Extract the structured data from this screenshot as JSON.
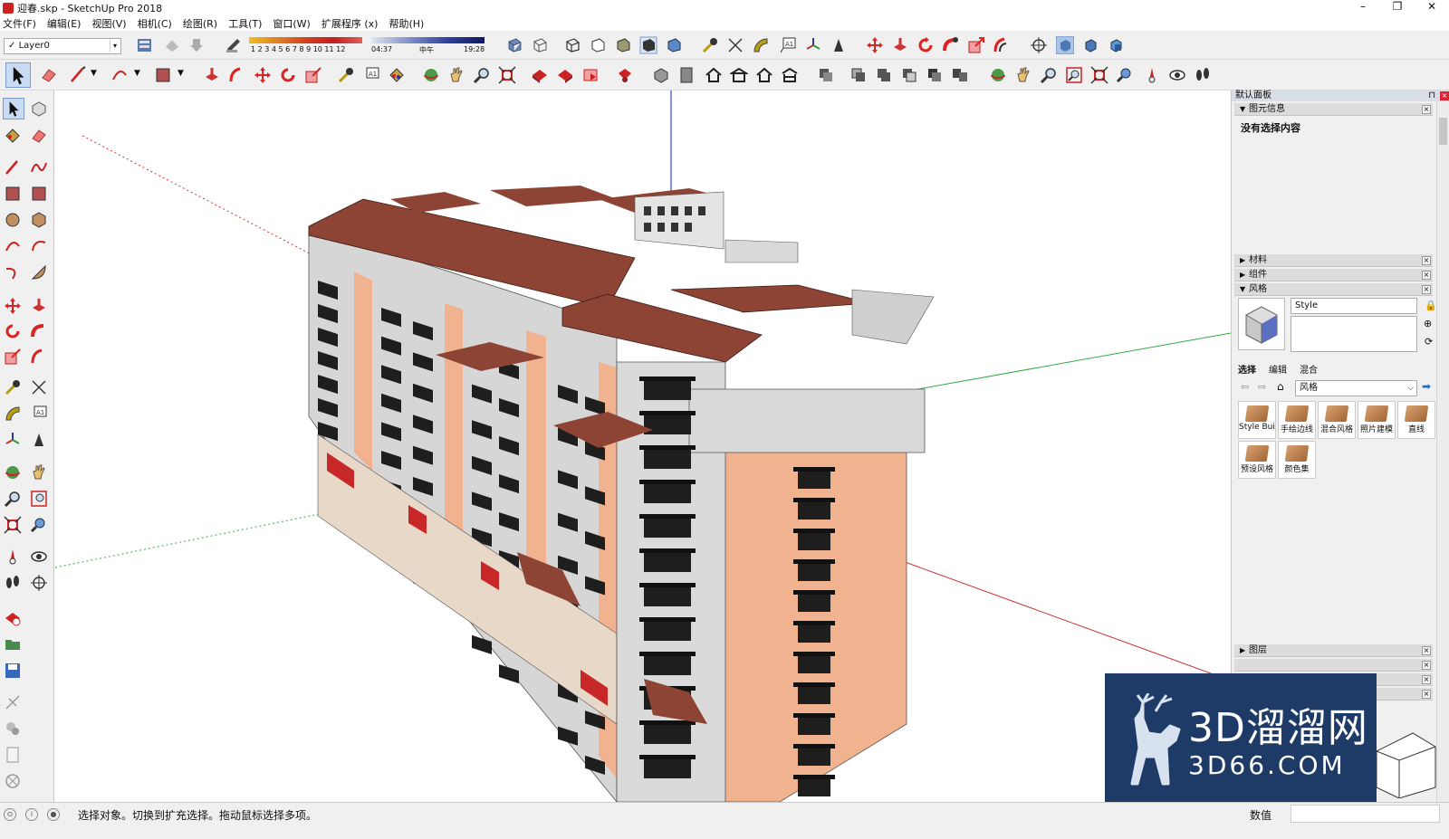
{
  "window": {
    "title": "迎春.skp - SketchUp Pro 2018",
    "minimize": "–",
    "maximize": "❐",
    "close": "✕"
  },
  "menu": [
    "文件(F)",
    "编辑(E)",
    "视图(V)",
    "相机(C)",
    "绘图(R)",
    "工具(T)",
    "窗口(W)",
    "扩展程序 (x)",
    "帮助(H)"
  ],
  "layer_toolbar": {
    "check": "✓",
    "current_layer": "Layer0",
    "dropdown": "▾"
  },
  "shadow_toolbar": {
    "months": "1 2 3 4 5 6 7 8 9 10 11 12",
    "time_start": "04:37",
    "time_mid": "中午",
    "time_end": "19:28"
  },
  "panel": {
    "title": "默认面板",
    "pin": "📌",
    "close": "×",
    "trays": [
      {
        "label": "图元信息",
        "open": true
      },
      {
        "label": "材料",
        "open": false
      },
      {
        "label": "组件",
        "open": false
      },
      {
        "label": "风格",
        "open": true
      },
      {
        "label": "图层",
        "open": false
      }
    ],
    "entity_info": {
      "text": "没有选择内容"
    },
    "styles": {
      "name": "Style",
      "tabs": [
        "选择",
        "编辑",
        "混合"
      ],
      "library": "风格",
      "tiles": [
        "Style Buil",
        "手绘边线",
        "混合风格",
        "照片建模",
        "直线",
        "预设风格",
        "颜色集"
      ]
    }
  },
  "status": {
    "message": "选择对象。切换到扩充选择。拖动鼠标选择多项。",
    "measurements_label": "数值"
  },
  "watermark": {
    "line1": "3D溜溜网",
    "line2": "3D66.COM"
  },
  "colors": {
    "roof": "#8e4434",
    "wall_orange": "#f1b28f",
    "wall_grey": "#d6d6d6",
    "window_dark": "#1e1e1e",
    "axis_red": "#cc3333",
    "axis_green": "#33aa44",
    "axis_blue": "#3344bb",
    "watermark_bg": "#1e3a66"
  }
}
